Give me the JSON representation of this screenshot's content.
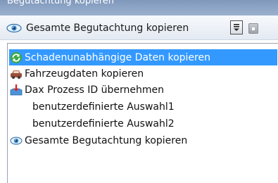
{
  "window": {
    "title": "Begutachtung kopieren"
  },
  "toolbar": {
    "label": "Gesamte Begutachtung kopieren",
    "icon": "eye-icon",
    "dropdown_icon": "dropdown-arrow-icon"
  },
  "menu": {
    "items": [
      {
        "label": "Schadenunabhängige Daten kopieren",
        "icon": "green-refresh-icon",
        "selected": true
      },
      {
        "label": "Fahrzeugdaten kopieren",
        "icon": "car-icon",
        "selected": false
      },
      {
        "label": "Dax Prozess ID übernehmen",
        "icon": "import-icon",
        "selected": false
      },
      {
        "label": "benutzerdefinierte Auswahl1",
        "icon": "",
        "selected": false
      },
      {
        "label": "benutzerdefinierte Auswahl2",
        "icon": "",
        "selected": false
      },
      {
        "label": "Gesamte Begutachtung kopieren",
        "icon": "eye-icon",
        "selected": false
      }
    ]
  },
  "colors": {
    "selection": "#3399ff",
    "titlebar": "#7f98bb"
  }
}
